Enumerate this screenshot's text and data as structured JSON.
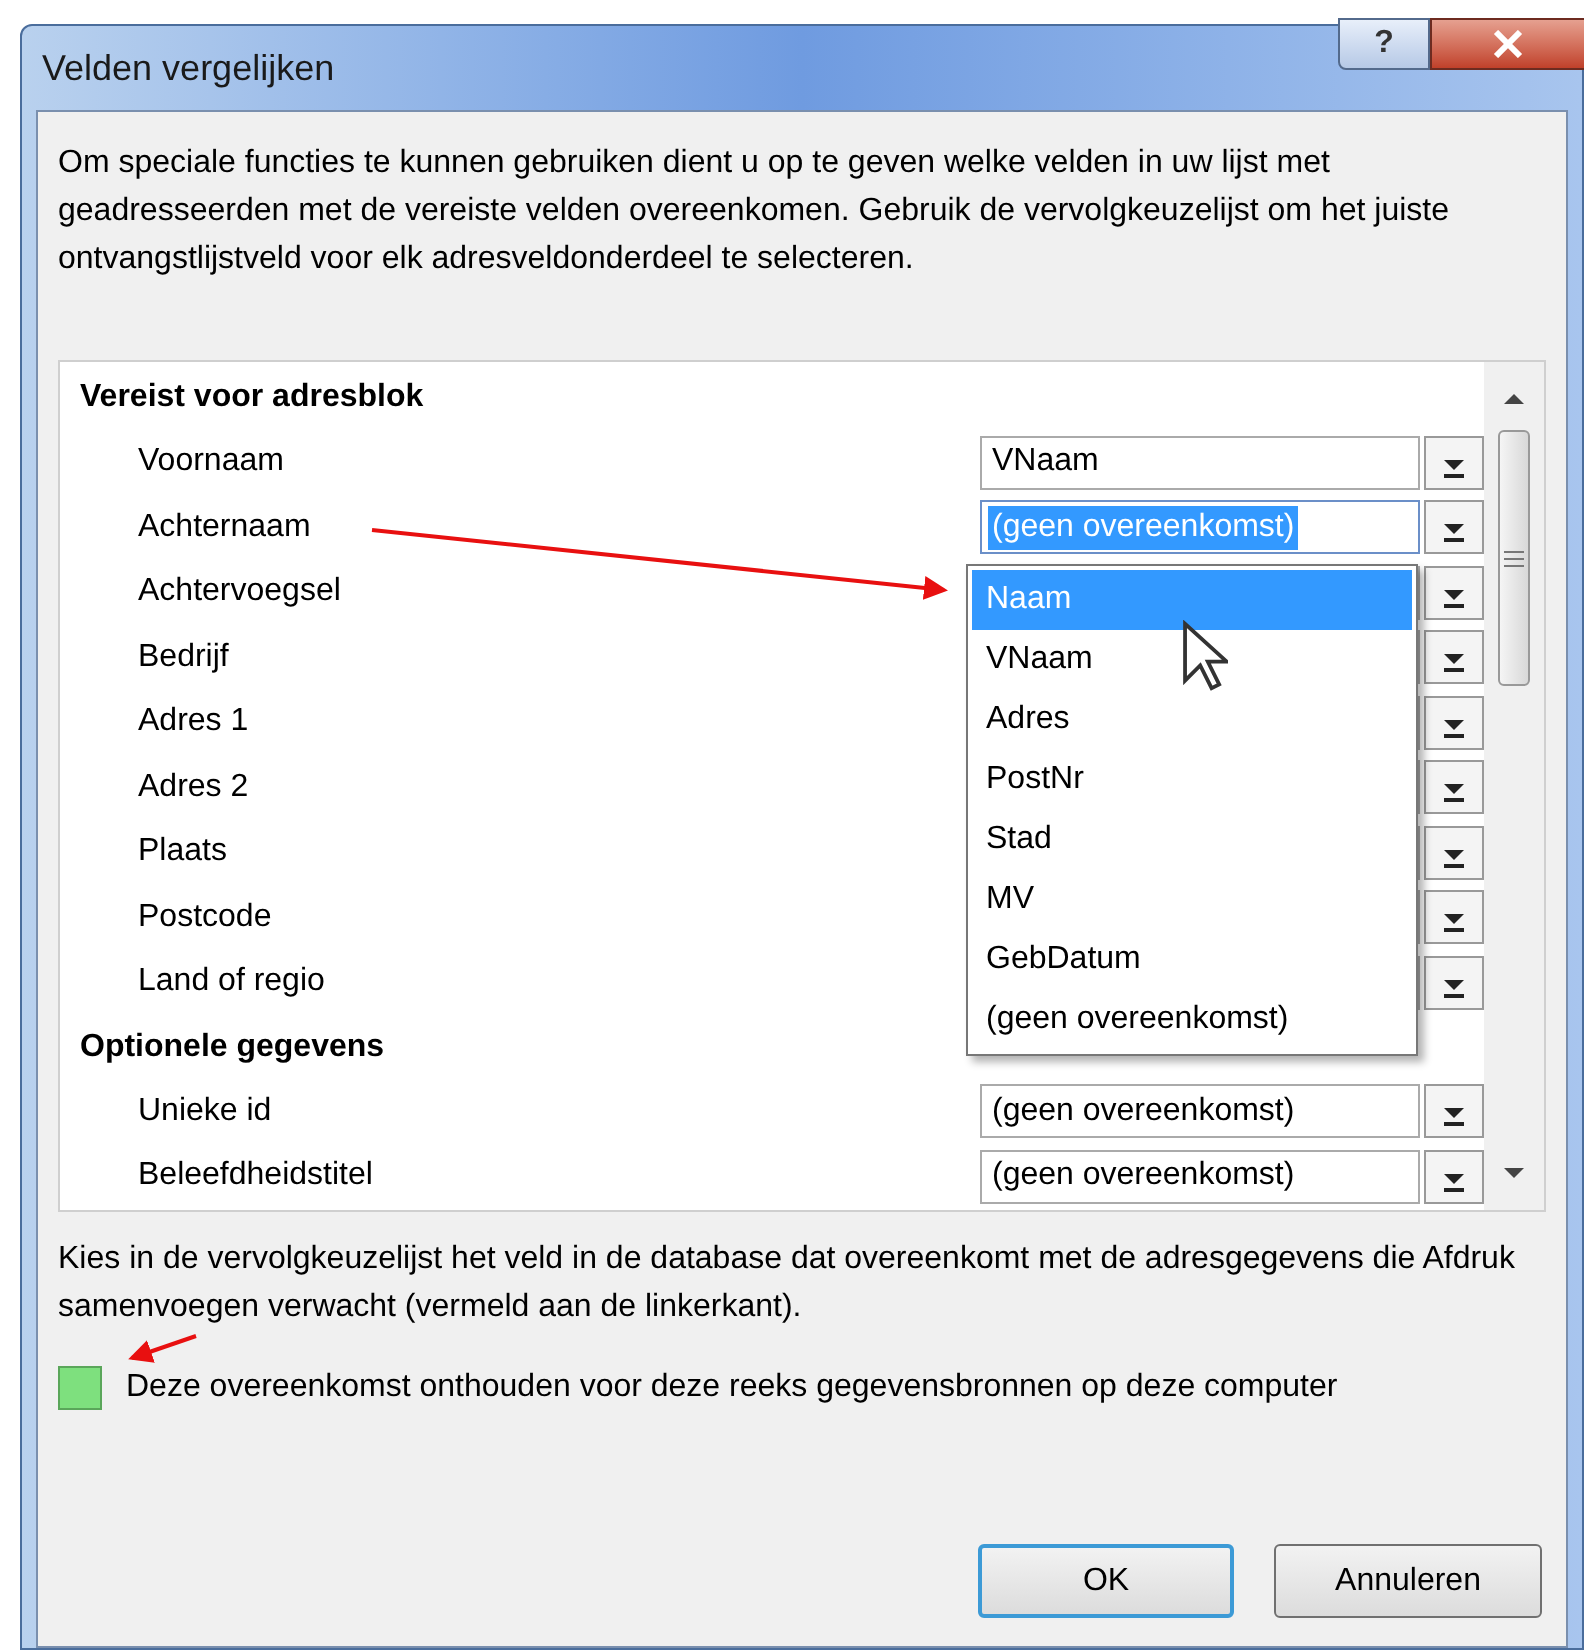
{
  "window": {
    "title": "Velden vergelijken",
    "help": "?"
  },
  "intro": "Om speciale functies te kunnen gebruiken dient u op te geven welke velden in uw lijst met geadresseerden met de vereiste velden overeenkomen. Gebruik de vervolgkeuzelijst om het juiste ontvangstlijstveld voor elk adresveldonderdeel te selecteren.",
  "groups": [
    {
      "heading": "Vereist voor adresblok",
      "fields": [
        {
          "label": "Voornaam",
          "value": "VNaam",
          "expanded": false
        },
        {
          "label": "Achternaam",
          "value": "(geen overeenkomst)",
          "expanded": true
        },
        {
          "label": "Achtervoegsel",
          "expanded": false
        },
        {
          "label": "Bedrijf",
          "expanded": false
        },
        {
          "label": "Adres 1",
          "expanded": false
        },
        {
          "label": "Adres 2",
          "expanded": false
        },
        {
          "label": "Plaats",
          "expanded": false
        },
        {
          "label": "Postcode",
          "expanded": false
        },
        {
          "label": "Land of regio",
          "expanded": false
        }
      ]
    },
    {
      "heading": "Optionele gegevens",
      "fields": [
        {
          "label": "Unieke id",
          "value": "(geen overeenkomst)",
          "expanded": false
        },
        {
          "label": "Beleefdheidstitel",
          "value": "(geen overeenkomst)",
          "expanded": false
        }
      ]
    }
  ],
  "dropdown_options": [
    {
      "label": "Naam",
      "selected": true
    },
    {
      "label": "VNaam",
      "selected": false
    },
    {
      "label": "Adres",
      "selected": false
    },
    {
      "label": "PostNr",
      "selected": false
    },
    {
      "label": "Stad",
      "selected": false
    },
    {
      "label": "MV",
      "selected": false
    },
    {
      "label": "GebDatum",
      "selected": false
    },
    {
      "label": "(geen overeenkomst)",
      "selected": false
    }
  ],
  "hint": "Kies in de vervolgkeuzelijst het veld in de database dat overeenkomt met de adresgegevens die Afdruk samenvoegen verwacht (vermeld aan de linkerkant).",
  "remember": {
    "label": "Deze overeenkomst onthouden voor deze reeks gegevensbronnen op deze computer",
    "checked": false
  },
  "buttons": [
    {
      "label": "OK",
      "default": true
    },
    {
      "label": "Annuleren",
      "default": false
    }
  ]
}
